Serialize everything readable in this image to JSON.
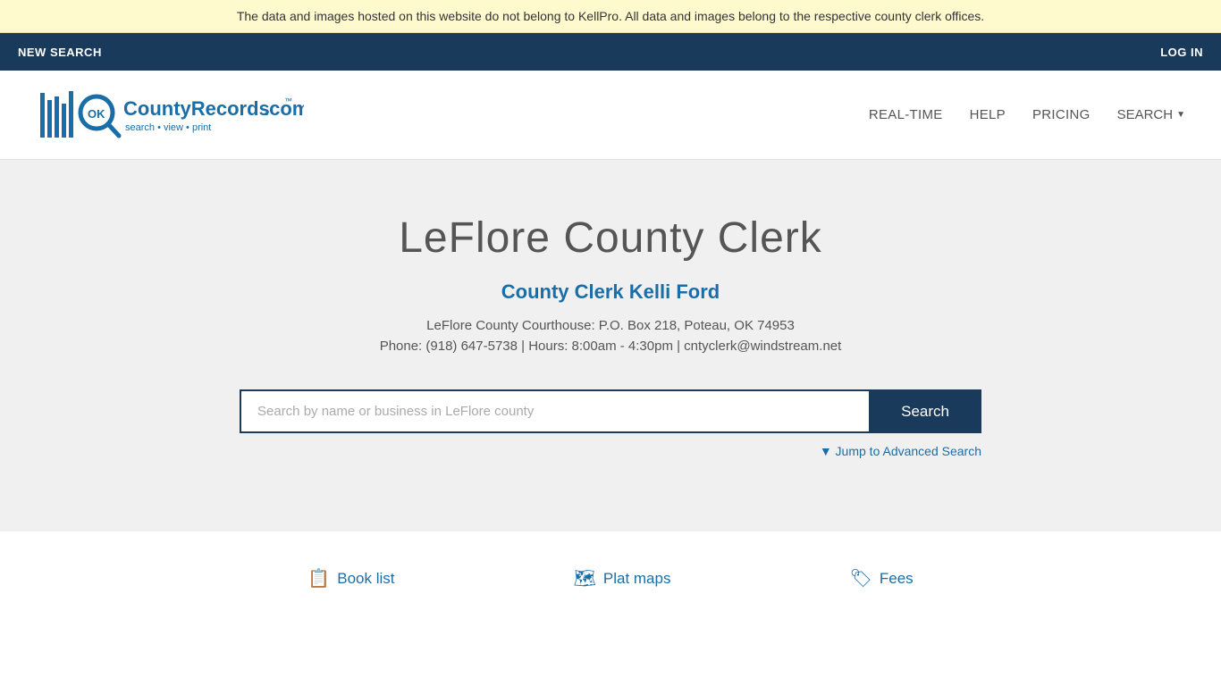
{
  "banner": {
    "text": "The data and images hosted on this website do not belong to KellPro. All data and images belong to the respective county clerk offices."
  },
  "topnav": {
    "new_search": "NEW SEARCH",
    "log_in": "LOG IN"
  },
  "header": {
    "logo_alt": "OKCountyRecords.com",
    "logo_tagline": "search • view • print",
    "nav": {
      "realtime": "REAL-TIME",
      "help": "HELP",
      "pricing": "PRICING",
      "search": "SEARCH"
    }
  },
  "hero": {
    "title": "LeFlore County Clerk",
    "clerk_name": "County Clerk Kelli Ford",
    "address": "LeFlore County Courthouse: P.O. Box 218, Poteau, OK 74953",
    "contact": "Phone: (918) 647-5738 | Hours: 8:00am - 4:30pm | cntyclerk@windstream.net",
    "search_placeholder": "Search by name or business in LeFlore county",
    "search_button": "Search",
    "advanced_search": "▼ Jump to Advanced Search"
  },
  "footer": {
    "links": [
      {
        "icon": "📋",
        "label": "Book list"
      },
      {
        "icon": "🗺",
        "label": "Plat maps"
      },
      {
        "icon": "🏷",
        "label": "Fees"
      }
    ]
  }
}
